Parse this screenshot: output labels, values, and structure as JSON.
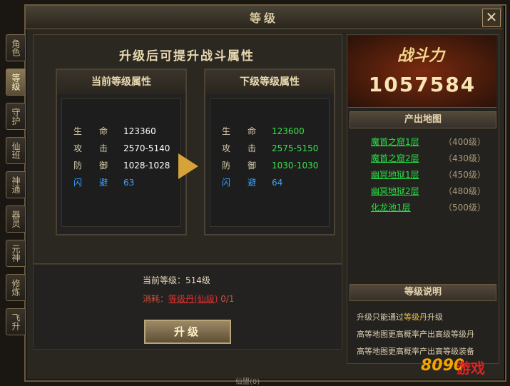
{
  "window": {
    "title": "等级",
    "close": "✕"
  },
  "tabs": [
    "角色",
    "等级",
    "守护",
    "仙班",
    "神通",
    "器灵",
    "元神",
    "修炼",
    "飞升"
  ],
  "heading": "升级后可提升战斗属性",
  "current": {
    "title": "当前等级属性",
    "rows": [
      {
        "name": "生　　命",
        "value": "123360"
      },
      {
        "name": "攻　　击",
        "value": "2570-5140"
      },
      {
        "name": "防　　御",
        "value": "1028-1028"
      },
      {
        "name": "闪　　避",
        "value": "63"
      }
    ]
  },
  "next": {
    "title": "下级等级属性",
    "rows": [
      {
        "name": "生　　命",
        "value": "123600"
      },
      {
        "name": "攻　　击",
        "value": "2575-5150"
      },
      {
        "name": "防　　御",
        "value": "1030-1030"
      },
      {
        "name": "闪　　避",
        "value": "64"
      }
    ]
  },
  "level_line": "当前等级：514级",
  "cost": {
    "label": "消耗：",
    "item": "等级丹(仙级)",
    "count": " 0/1"
  },
  "upgrade_button": "升级",
  "power": {
    "label": "战斗力",
    "value": "1057584"
  },
  "maps_header": "产出地图",
  "maps": [
    {
      "name": "魔首之窟1层",
      "level": "（400级）"
    },
    {
      "name": "魔首之窟2层",
      "level": "（430级）"
    },
    {
      "name": "幽冥地狱1层",
      "level": "（450级）"
    },
    {
      "name": "幽冥地狱2层",
      "level": "（480级）"
    },
    {
      "name": "化龙池1层",
      "level": "（500级）"
    }
  ],
  "desc_header": "等级说明",
  "desc": {
    "line1_a": "升级只能通过",
    "line1_hl": "等级丹",
    "line1_b": "升级",
    "line2": "高等地图更高概率产出高级等级丹",
    "line3": "高等地图更高概率产出高等级装备"
  },
  "logo": {
    "a": "8090",
    "b": "游戏"
  },
  "footer": "仙盟(0)"
}
